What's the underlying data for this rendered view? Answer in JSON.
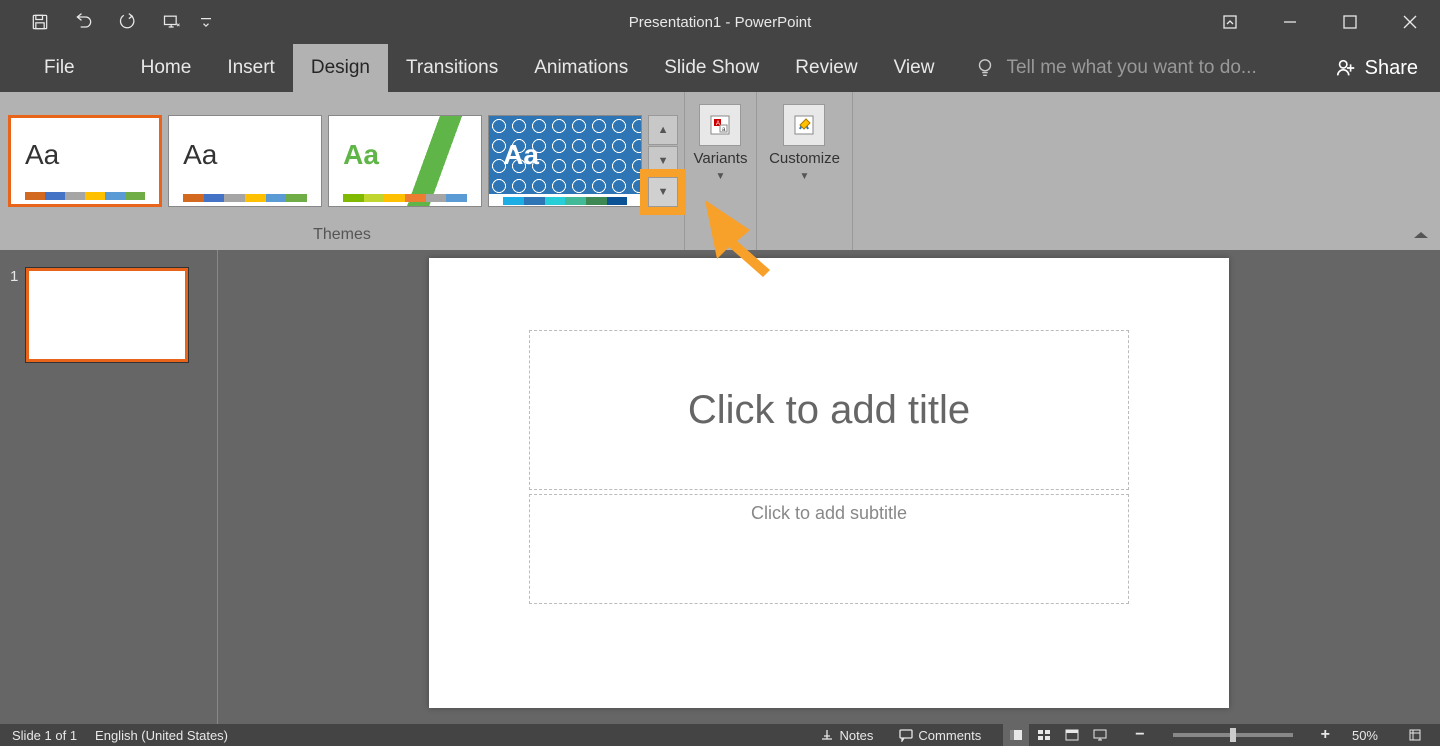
{
  "titlebar": {
    "title": "Presentation1 - PowerPoint"
  },
  "tabs": {
    "file": "File",
    "home": "Home",
    "insert": "Insert",
    "design": "Design",
    "transitions": "Transitions",
    "animations": "Animations",
    "slideshow": "Slide Show",
    "review": "Review",
    "view": "View",
    "tellme": "Tell me what you want to do...",
    "share": "Share"
  },
  "ribbon": {
    "themes_label": "Themes",
    "variants_label": "Variants",
    "customize_label": "Customize",
    "theme_sample": "Aa"
  },
  "thumbnails": {
    "slide1_num": "1"
  },
  "canvas": {
    "title_placeholder": "Click to add title",
    "subtitle_placeholder": "Click to add subtitle"
  },
  "statusbar": {
    "slide_info": "Slide 1 of 1",
    "language": "English (United States)",
    "notes": "Notes",
    "comments": "Comments",
    "zoom": "50%"
  }
}
